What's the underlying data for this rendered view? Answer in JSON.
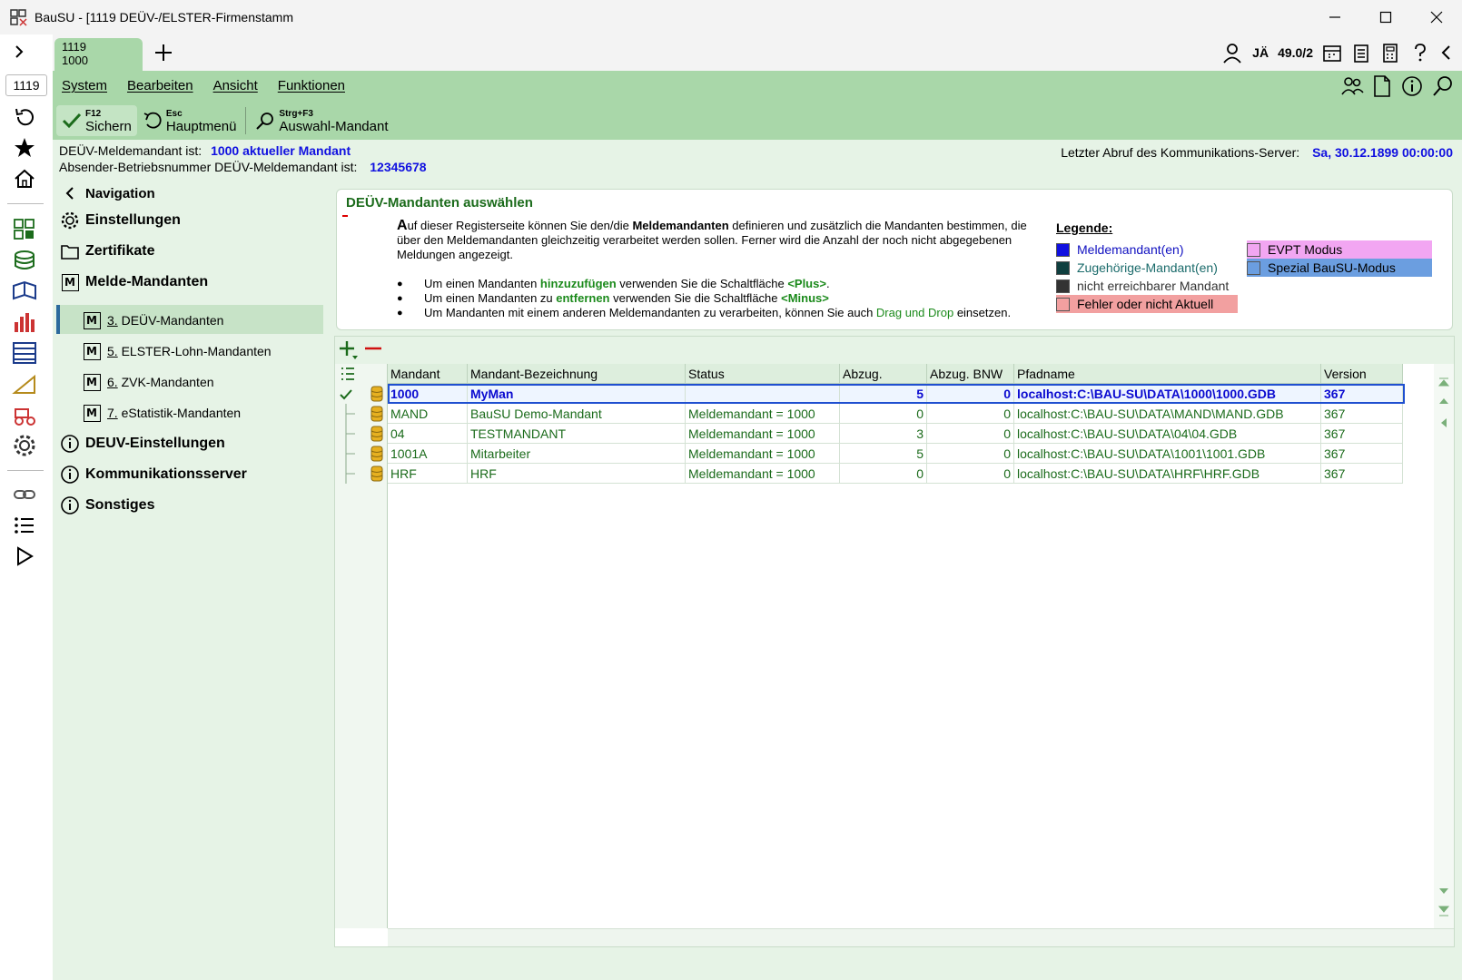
{
  "window": {
    "title": "BauSU - [1119 DEÜV-/ELSTER-Firmenstamm"
  },
  "tab": {
    "line1": "1119",
    "line2": "1000"
  },
  "rail": {
    "mandant": "1119"
  },
  "header": {
    "user": "JÄ",
    "version": "49.0/2"
  },
  "menu": {
    "system": "System",
    "bearbeiten": "Bearbeiten",
    "ansicht": "Ansicht",
    "funktionen": "Funktionen"
  },
  "toolbar": {
    "save_key": "F12",
    "save_label": "Sichern",
    "main_key": "Esc",
    "main_label": "Hauptmenü",
    "select_key": "Strg+F3",
    "select_label": "Auswahl-Mandant"
  },
  "info": {
    "line1_label": "DEÜV-Meldemandant ist:",
    "line1_value": "1000 aktueller Mandant",
    "line2_label": "Absender-Betriebsnummer DEÜV-Meldemandant ist:",
    "line2_value": "12345678",
    "server_label": "Letzter Abruf des Kommunikations-Server:",
    "server_value": "Sa, 30.12.1899 00:00:00"
  },
  "nav": {
    "back": "Navigation",
    "items": [
      {
        "label": "Einstellungen"
      },
      {
        "label": "Zertifikate"
      },
      {
        "label": "Melde-Mandanten"
      },
      {
        "num": "3.",
        "label": "DEÜV-Mandanten"
      },
      {
        "num": "5.",
        "label": "ELSTER-Lohn-Mandanten"
      },
      {
        "num": "6.",
        "label": "ZVK-Mandanten"
      },
      {
        "num": "7.",
        "label": "eStatistik-Mandanten"
      },
      {
        "label": "DEUV-Einstellungen"
      },
      {
        "label": "Kommunikationsserver"
      },
      {
        "label": "Sonstiges"
      }
    ]
  },
  "desc": {
    "heading": "DEÜV-Mandanten auswählen",
    "p_cap": "A",
    "p_1": "uf dieser Registerseite können Sie den/die ",
    "p_bold": "Meldemandanten",
    "p_2": " definieren und zusätzlich die Mandanten bestimmen, die über den Meldemandanten gleichzeitig verarbeitet werden sollen. Ferner wird die Anzahl der noch nicht abgegebenen Meldungen angezeigt.",
    "b1_a": "Um einen Mandanten ",
    "b1_g": "hinzuzufügen",
    "b1_b": " verwenden Sie die Schaltfläche ",
    "b1_c": "<Plus>",
    "b1_d": ".",
    "b2_a": "Um einen Mandanten zu ",
    "b2_g": "entfernen",
    "b2_b": " verwenden Sie die Schaltfläche ",
    "b2_c": "<Minus>",
    "b3_a": "Um Mandanten mit einem anderen Meldemandanten zu verarbeiten, können Sie auch ",
    "b3_g": "Drag und Drop",
    "b3_b": " einsetzen."
  },
  "legend": {
    "title": "Legende:",
    "items": [
      {
        "label": "Meldemandant(en)",
        "color": "#1010e0"
      },
      {
        "label": "Zugehörige-Mandant(en)",
        "color": "#0f3f3f"
      },
      {
        "label": "nicht erreichbarer Mandant",
        "color": "#333333"
      },
      {
        "label": "Fehler oder nicht Aktuell",
        "color": "#f2a0a0"
      },
      {
        "label": "EVPT Modus",
        "color": "#f2a6f2"
      },
      {
        "label": "Spezial BauSU-Modus",
        "color": "#6b9ee0"
      }
    ]
  },
  "grid": {
    "columns": [
      "Mandant",
      "Mandant-Bezeichnung",
      "Status",
      "Abzug.",
      "Abzug. BNW",
      "Pfadname",
      "Version"
    ],
    "rows": [
      [
        "1000",
        "MyMan",
        "",
        "5",
        "0",
        "localhost:C:\\BAU-SU\\DATA\\1000\\1000.GDB",
        "367"
      ],
      [
        "MAND",
        "BauSU Demo-Mandant",
        "Meldemandant = 1000",
        "0",
        "0",
        "localhost:C:\\BAU-SU\\DATA\\MAND\\MAND.GDB",
        "367"
      ],
      [
        "04",
        "TESTMANDANT",
        "Meldemandant = 1000",
        "3",
        "0",
        "localhost:C:\\BAU-SU\\DATA\\04\\04.GDB",
        "367"
      ],
      [
        "1001A",
        "Mitarbeiter",
        "Meldemandant = 1000",
        "5",
        "0",
        "localhost:C:\\BAU-SU\\DATA\\1001\\1001.GDB",
        "367"
      ],
      [
        "HRF",
        "HRF",
        "Meldemandant = 1000",
        "0",
        "0",
        "localhost:C:\\BAU-SU\\DATA\\HRF\\HRF.GDB",
        "367"
      ]
    ]
  },
  "colors": {
    "green_dark": "#a9d7a9",
    "green_light": "#e6f3e6",
    "accent_blue": "#1010e0"
  }
}
